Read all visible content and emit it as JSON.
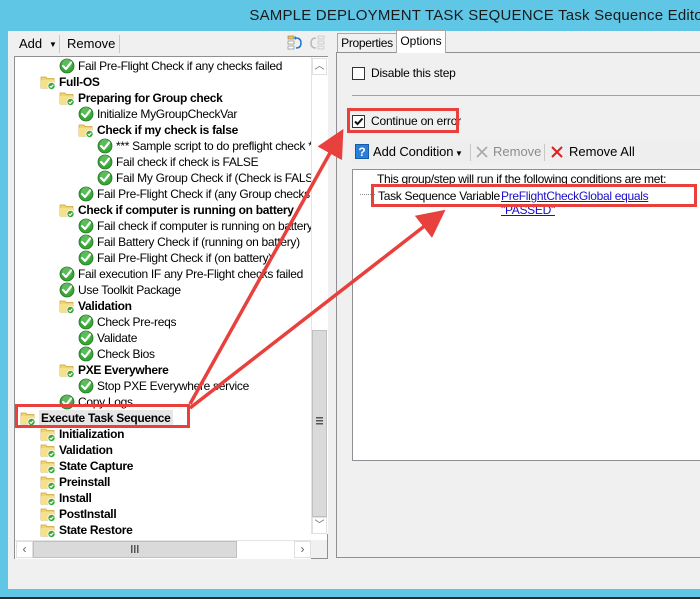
{
  "window": {
    "title": "SAMPLE DEPLOYMENT TASK SEQUENCE Task Sequence Editor"
  },
  "left_toolbar": {
    "add_label": "Add",
    "remove_label": "Remove",
    "move_up_icon": "move-up-icon",
    "move_down_icon": "move-down-icon"
  },
  "tree": {
    "items": [
      {
        "label": "Fail Pre-Flight Check if any checks failed",
        "type": "step",
        "level": 3
      },
      {
        "label": "Full-OS",
        "type": "group",
        "level": 2
      },
      {
        "label": "Preparing for Group check",
        "type": "group",
        "level": 3
      },
      {
        "label": "Initialize MyGroupCheckVar",
        "type": "step",
        "level": 4
      },
      {
        "label": "Check if my check is false",
        "type": "group",
        "level": 4
      },
      {
        "label": "*** Sample script to do preflight check ***",
        "type": "step",
        "level": 5
      },
      {
        "label": "Fail check if check is FALSE",
        "type": "step",
        "level": 5
      },
      {
        "label": "Fail My Group Check if (Check is FALSE)",
        "type": "step",
        "level": 5
      },
      {
        "label": "Fail Pre-Flight Check if (any Group checks failed)",
        "type": "step",
        "level": 4
      },
      {
        "label": "Check if computer is running on battery",
        "type": "group",
        "level": 3
      },
      {
        "label": "Fail check if computer is running on battery",
        "type": "step",
        "level": 4
      },
      {
        "label": "Fail Battery Check if (running on battery)",
        "type": "step",
        "level": 4
      },
      {
        "label": "Fail Pre-Flight Check if (on battery)",
        "type": "step",
        "level": 4
      },
      {
        "label": "Fail execution IF any Pre-Flight checks failed",
        "type": "step",
        "level": 3
      },
      {
        "label": "Use Toolkit Package",
        "type": "step",
        "level": 3
      },
      {
        "label": "Validation",
        "type": "group",
        "level": 3
      },
      {
        "label": "Check Pre-reqs",
        "type": "step",
        "level": 4
      },
      {
        "label": "Validate",
        "type": "step",
        "level": 4
      },
      {
        "label": "Check Bios",
        "type": "step",
        "level": 4
      },
      {
        "label": "PXE Everywhere",
        "type": "group",
        "level": 3
      },
      {
        "label": "Stop PXE Everywhere service",
        "type": "step",
        "level": 4
      },
      {
        "label": "Copy Logs",
        "type": "step",
        "level": 3
      },
      {
        "label": "Execute Task Sequence",
        "type": "group",
        "level": 1,
        "selected": true
      },
      {
        "label": "Initialization",
        "type": "group",
        "level": 2
      },
      {
        "label": "Validation",
        "type": "group",
        "level": 2
      },
      {
        "label": "State Capture",
        "type": "group",
        "level": 2
      },
      {
        "label": "Preinstall",
        "type": "group",
        "level": 2
      },
      {
        "label": "Install",
        "type": "group",
        "level": 2
      },
      {
        "label": "PostInstall",
        "type": "group",
        "level": 2
      },
      {
        "label": "State Restore",
        "type": "group",
        "level": 2
      }
    ],
    "vertical_scroll_position": 0.85,
    "horizontal_scroll_position": 0.0
  },
  "tabs": [
    {
      "label": "Properties",
      "active": false
    },
    {
      "label": "Options",
      "active": true
    }
  ],
  "options": {
    "disable_step_label": "Disable this step",
    "disable_step_checked": false,
    "continue_on_error_label": "Continue on error",
    "continue_on_error_checked": true
  },
  "condition_toolbar": {
    "add_condition_label": "Add Condition",
    "remove_label": "Remove",
    "remove_all_label": "Remove All"
  },
  "conditions": {
    "header": "This group/step will run if the following conditions are met:",
    "items": [
      {
        "type_label": "Task Sequence Variable",
        "expression": "PreFlightCheckGlobal equals \"PASSED\""
      }
    ]
  },
  "colors": {
    "titlebar": "#5fc6e6",
    "annotation_red": "#e8403d",
    "link_blue": "#1a0dcc",
    "check_green": "#3aa63a",
    "folder_yellow": "#f2d46a"
  }
}
